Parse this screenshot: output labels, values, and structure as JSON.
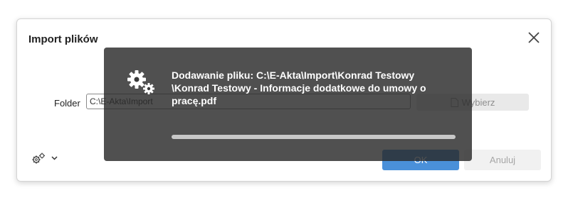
{
  "dialog": {
    "title": "Import plików",
    "folder_label": "Folder",
    "folder_value": "C:\\E-Akta\\Import",
    "choose_label": "Wybierz",
    "ok_label": "OK",
    "cancel_label": "Anuluj"
  },
  "icons": {
    "close": "close-icon",
    "settings": "gears-icon",
    "dropdown": "chevron-down-icon",
    "file": "file-icon"
  },
  "progress": {
    "message_lines": [
      "Dodawanie pliku: C:\\E-Akta\\Import\\Konrad Testowy",
      "\\Konrad Testowy - Informacje dodatkowe do umowy o",
      "pracę.pdf"
    ],
    "fraction": 1.0
  },
  "colors": {
    "accent": "#4a90d9",
    "overlay": "#2a2a2a"
  }
}
